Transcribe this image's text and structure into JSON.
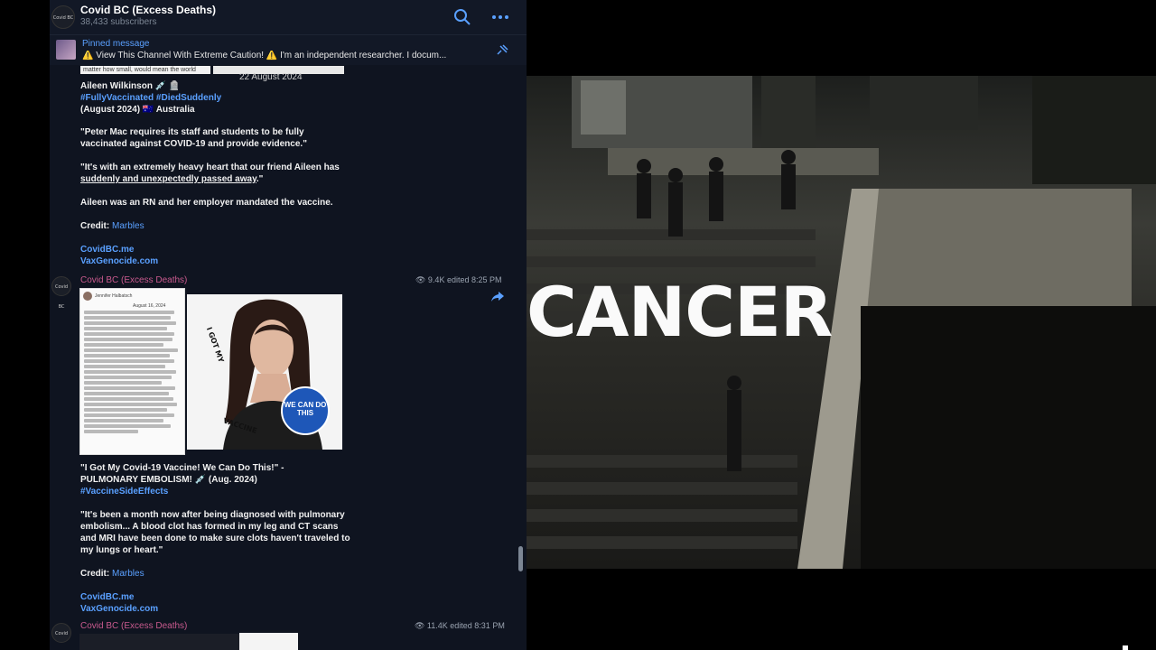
{
  "channel": {
    "title": "Covid BC (Excess Deaths)",
    "subscribers": "38,433 subscribers",
    "avatar_text": "Covid BC"
  },
  "pinned": {
    "label": "Pinned message",
    "text": "⚠️ View This Channel With Extreme Caution! ⚠️  I'm an independent researcher.  I docum..."
  },
  "snippet": {
    "left": "matter how small, would mean the world",
    "date": "22 August 2024"
  },
  "post1": {
    "name": "Aileen Wilkinson 💉 🪦",
    "tags": "#FullyVaccinated #DiedSuddenly",
    "meta": "(August 2024) 🇦🇺  Australia",
    "p1": "\"Peter Mac requires its staff and students to be fully vaccinated against COVID-19 and provide evidence.\"",
    "p2a": "\"It's with an extremely heavy heart that our friend Aileen has ",
    "p2b": "suddenly and unexpectedly passed away",
    "p2c": ".\"",
    "p3": "Aileen was an RN and her employer mandated the vaccine.",
    "credit_label": "Credit:",
    "credit_value": "Marbles",
    "link1": "CovidBC.me",
    "link2": "VaxGenocide.com"
  },
  "post2": {
    "author": "Covid BC (Excess Deaths)",
    "views": "👁 9.4K edited 8:25 PM",
    "headline1": "\"I Got My Covid-19 Vaccine! We Can Do This!\" -",
    "headline2": "PULMONARY EMBOLISM! 💉 (Aug. 2024)",
    "tags": "#VaccineSideEffects",
    "p1": "\"It's been a month now after being diagnosed with pulmonary embolism... A blood clot has formed in my leg and CT scans and MRI have been done to make sure clots haven't traveled to my lungs or heart.\"",
    "credit_label": "Credit:",
    "credit_value": "Marbles",
    "link1": "CovidBC.me",
    "link2": "VaxGenocide.com",
    "photo_name": "Jennifer Halbatsch",
    "photo_date": "August 16, 2024",
    "badge": "WE CAN DO THIS",
    "arc_text": "I GOT MY COVID-19 VACCINE"
  },
  "post3": {
    "author": "Covid BC (Excess Deaths)",
    "views": "👁 11.4K edited 8:31 PM"
  },
  "video": {
    "caption": "CANCER"
  },
  "colors": {
    "accent": "#5aa0ff",
    "author": "#c95a8e",
    "panel": "#0f1420"
  }
}
